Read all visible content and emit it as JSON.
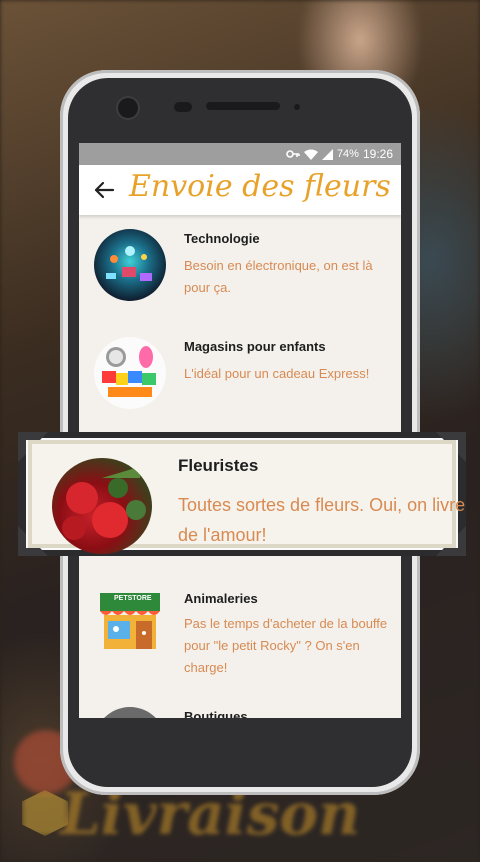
{
  "status": {
    "battery": "74%",
    "time": "19:26"
  },
  "header": {
    "title": "Envoie des fleurs"
  },
  "items": [
    {
      "title": "Technologie",
      "desc": "Besoin en électronique, on est là pour ça."
    },
    {
      "title": "Magasins pour enfants",
      "desc": "L'idéal pour un cadeau Express!"
    },
    {
      "title": "Fleuristes",
      "desc": "Toutes sortes de fleurs. Oui, on livre de l'amour!"
    },
    {
      "title": "Animaleries",
      "desc": "Pas le temps d'acheter de la bouffe pour \"le petit Rocky\" ? On s'en charge!"
    },
    {
      "title": "Boutiques",
      "desc": ""
    }
  ],
  "pet_store_sign": "PETSTORE",
  "background": {
    "logo_text": "Livraison"
  },
  "colors": {
    "accent": "#e8a22a",
    "description": "#d88a52",
    "status_bar": "#9e9e9e"
  }
}
